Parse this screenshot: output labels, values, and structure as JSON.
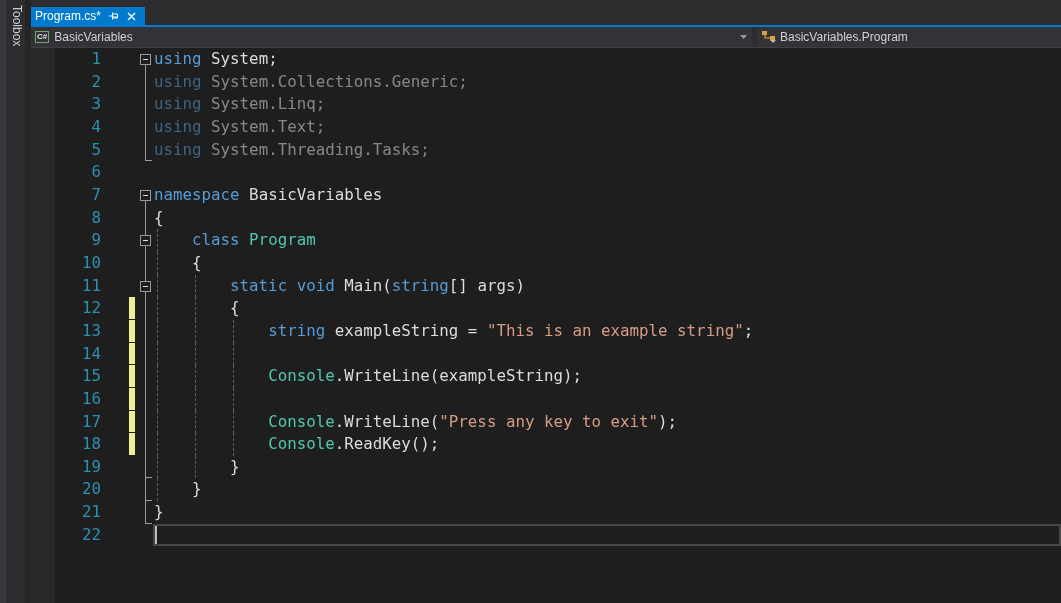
{
  "toolbox": {
    "label": "Toolbox"
  },
  "tabs": [
    {
      "label": "Program.cs*",
      "selected": true
    }
  ],
  "navigation": {
    "project": {
      "badge": "C#",
      "label": "BasicVariables"
    },
    "member": {
      "label": "BasicVariables.Program"
    }
  },
  "editor": {
    "lines": [
      {
        "number": "1",
        "tokens": [
          {
            "kind": "keyword",
            "text": "using"
          },
          {
            "kind": "plain",
            "text": " System;"
          }
        ],
        "faded": false,
        "changed": false,
        "current": false,
        "outline": {
          "kind": "fold",
          "expanded": true
        }
      },
      {
        "number": "2",
        "tokens": [
          {
            "kind": "keyword",
            "text": "using"
          },
          {
            "kind": "plain",
            "text": " System.Collections.Generic;"
          }
        ],
        "faded": true,
        "changed": false,
        "current": false,
        "outline": {
          "kind": "bar"
        }
      },
      {
        "number": "3",
        "tokens": [
          {
            "kind": "keyword",
            "text": "using"
          },
          {
            "kind": "plain",
            "text": " System.Linq;"
          }
        ],
        "faded": true,
        "changed": false,
        "current": false,
        "outline": {
          "kind": "bar"
        }
      },
      {
        "number": "4",
        "tokens": [
          {
            "kind": "keyword",
            "text": "using"
          },
          {
            "kind": "plain",
            "text": " System.Text;"
          }
        ],
        "faded": true,
        "changed": false,
        "current": false,
        "outline": {
          "kind": "bar"
        }
      },
      {
        "number": "5",
        "tokens": [
          {
            "kind": "keyword",
            "text": "using"
          },
          {
            "kind": "plain",
            "text": " System.Threading.Tasks;"
          }
        ],
        "faded": true,
        "changed": false,
        "current": false,
        "outline": {
          "kind": "end"
        }
      },
      {
        "number": "6",
        "changed": false,
        "current": false
      },
      {
        "number": "7",
        "tokens": [
          {
            "kind": "keyword",
            "text": "namespace"
          },
          {
            "kind": "plain",
            "text": " BasicVariables"
          }
        ],
        "faded": false,
        "changed": false,
        "current": false,
        "outline": {
          "kind": "fold",
          "expanded": true
        }
      },
      {
        "number": "8",
        "tokens": [
          {
            "kind": "plain",
            "text": "{"
          }
        ],
        "faded": false,
        "changed": false,
        "current": false,
        "outline": {
          "kind": "bar"
        },
        "children": [
          {
            "number": "9",
            "tokens": [
              {
                "kind": "keyword",
                "text": "class "
              },
              {
                "kind": "type",
                "text": "Program"
              }
            ],
            "faded": false,
            "changed": false,
            "current": false,
            "outline": {
              "kind": "fold",
              "expanded": true
            }
          },
          {
            "number": "10",
            "tokens": [
              {
                "kind": "plain",
                "text": "{"
              }
            ],
            "faded": false,
            "changed": false,
            "current": false,
            "outline": {
              "kind": "bar"
            },
            "children": [
              {
                "number": "11",
                "tokens": [
                  {
                    "kind": "keyword",
                    "text": "static void"
                  },
                  {
                    "kind": "plain",
                    "text": " Main("
                  },
                  {
                    "kind": "keyword",
                    "text": "string"
                  },
                  {
                    "kind": "plain",
                    "text": "[] args)"
                  }
                ],
                "faded": false,
                "changed": false,
                "current": false,
                "outline": {
                  "kind": "fold",
                  "expanded": true
                }
              },
              {
                "number": "12",
                "tokens": [
                  {
                    "kind": "plain",
                    "text": "{"
                  }
                ],
                "faded": false,
                "changed": true,
                "current": false,
                "outline": {
                  "kind": "bar"
                },
                "children": [
                  {
                    "number": "13",
                    "tokens": [
                      {
                        "kind": "keyword",
                        "text": "string"
                      },
                      {
                        "kind": "plain",
                        "text": " exampleString = "
                      },
                      {
                        "kind": "string",
                        "text": "\"This is an example string\""
                      },
                      {
                        "kind": "plain",
                        "text": ";"
                      }
                    ],
                    "faded": false,
                    "changed": true,
                    "current": false,
                    "outline": {
                      "kind": "bar"
                    }
                  },
                  {
                    "number": "14",
                    "changed": true,
                    "current": false,
                    "outline": {
                      "kind": "bar"
                    }
                  },
                  {
                    "number": "15",
                    "tokens": [
                      {
                        "kind": "type",
                        "text": "Console"
                      },
                      {
                        "kind": "plain",
                        "text": ".WriteLine(exampleString);"
                      }
                    ],
                    "faded": false,
                    "changed": true,
                    "current": false,
                    "outline": {
                      "kind": "bar"
                    }
                  },
                  {
                    "number": "16",
                    "changed": true,
                    "current": false,
                    "outline": {
                      "kind": "bar"
                    }
                  },
                  {
                    "number": "17",
                    "tokens": [
                      {
                        "kind": "type",
                        "text": "Console"
                      },
                      {
                        "kind": "plain",
                        "text": ".WriteLine("
                      },
                      {
                        "kind": "string",
                        "text": "\"Press any key to exit\""
                      },
                      {
                        "kind": "plain",
                        "text": ");"
                      }
                    ],
                    "faded": false,
                    "changed": true,
                    "current": false,
                    "outline": {
                      "kind": "bar"
                    }
                  },
                  {
                    "number": "18",
                    "tokens": [
                      {
                        "kind": "type",
                        "text": "Console"
                      },
                      {
                        "kind": "plain",
                        "text": ".ReadKey();"
                      }
                    ],
                    "faded": false,
                    "changed": true,
                    "current": false,
                    "outline": {
                      "kind": "bar"
                    }
                  }
                ]
              },
              {
                "number": "19",
                "tokens": [
                  {
                    "kind": "plain",
                    "text": "}"
                  }
                ],
                "faded": false,
                "changed": false,
                "current": false,
                "outline": {
                  "kind": "end"
                }
              }
            ]
          },
          {
            "number": "20",
            "tokens": [
              {
                "kind": "plain",
                "text": "}"
              }
            ],
            "faded": false,
            "changed": false,
            "current": false,
            "outline": {
              "kind": "end"
            }
          }
        ]
      },
      {
        "number": "21",
        "tokens": [
          {
            "kind": "plain",
            "text": "}"
          }
        ],
        "faded": false,
        "changed": false,
        "current": false,
        "outline": {
          "kind": "end"
        }
      },
      {
        "number": "22",
        "changed": false,
        "current": true
      }
    ]
  }
}
